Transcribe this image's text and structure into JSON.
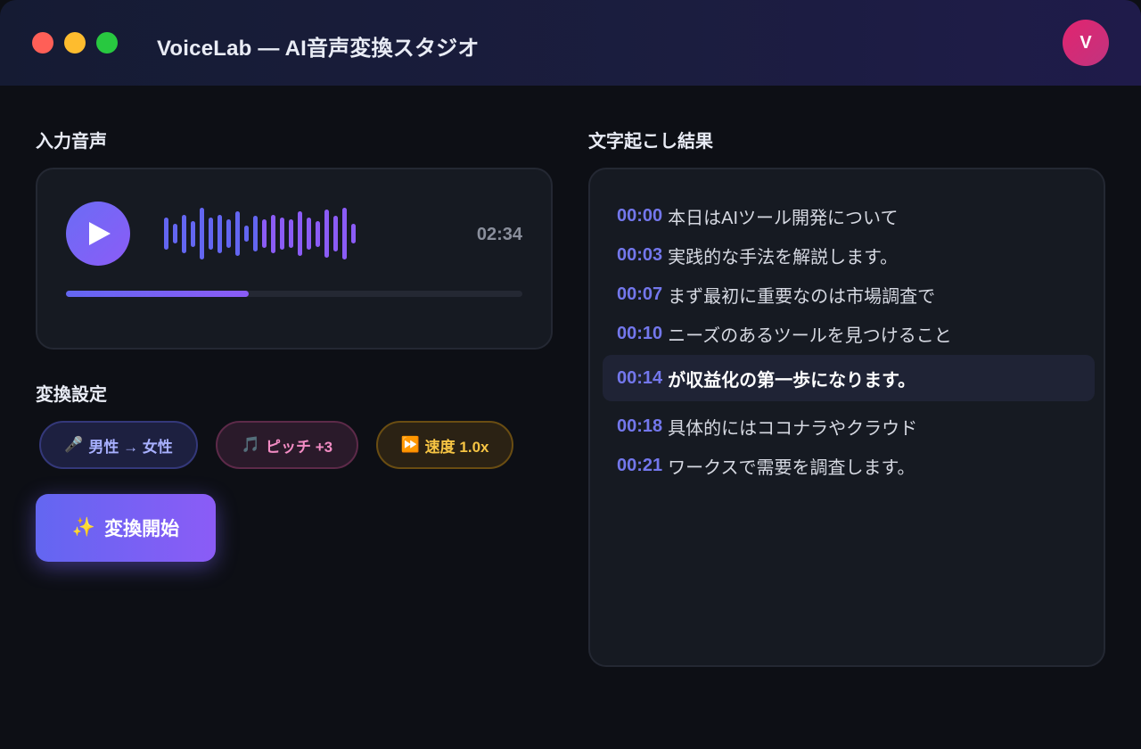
{
  "window": {
    "title": "VoiceLab — AI音声変換スタジオ",
    "avatar_initial": "V"
  },
  "input_section": {
    "heading": "入力音声",
    "duration": "02:34",
    "progress": 0.4,
    "waveform_levels": [
      0.5,
      0.3,
      0.6,
      0.4,
      0.8,
      0.5,
      0.6,
      0.45,
      0.7,
      0.25,
      0.55,
      0.45,
      0.6,
      0.5,
      0.45,
      0.7,
      0.5,
      0.4,
      0.75,
      0.55,
      0.8,
      0.3
    ],
    "colors": {
      "accent": "#6366f1",
      "accent2": "#8b5cf6"
    }
  },
  "settings_section": {
    "heading": "変換設定",
    "chips": [
      {
        "icon": "microphone-icon",
        "glyph": "🎤",
        "label": "男性 → 女性"
      },
      {
        "icon": "music-note-icon",
        "glyph": "🎵",
        "label": "ピッチ +3"
      },
      {
        "icon": "fast-forward-icon",
        "glyph": "⏩",
        "label": "速度 1.0x"
      }
    ],
    "convert_button": {
      "icon": "sparkles-icon",
      "glyph": "✨",
      "label": "変換開始"
    }
  },
  "transcript_section": {
    "heading": "文字起こし結果",
    "lines": [
      {
        "time": "00:00",
        "text": "本日はAIツール開発について"
      },
      {
        "time": "00:03",
        "text": "実践的な手法を解説します。"
      },
      {
        "time": "00:07",
        "text": "まず最初に重要なのは市場調査で"
      },
      {
        "time": "00:10",
        "text": "ニーズのあるツールを見つけること"
      },
      {
        "time": "00:14",
        "text": "が収益化の第一歩になります。"
      },
      {
        "time": "00:18",
        "text": "具体的にはココナラやクラウド"
      },
      {
        "time": "00:21",
        "text": "ワークスで需要を調査します。"
      }
    ]
  }
}
